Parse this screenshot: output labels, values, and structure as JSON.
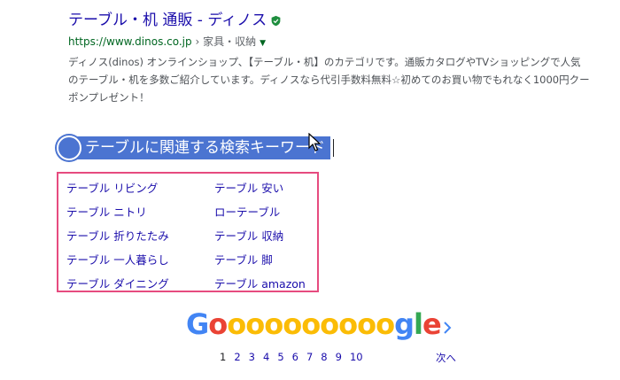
{
  "result": {
    "title": "テーブル・机 通販 - ディノス",
    "url": "https://www.dinos.co.jp",
    "breadcrumb": " › 家具・収納",
    "dropdown_glyph": "▼",
    "snippet": "ディノス(dinos) オンラインショップ、【テーブル・机】のカテゴリです。通販カタログやTVショッピングで人気のテーブル・机を多数ご紹介しています。ディノスなら代引手数料無料☆初めてのお買い物でもれなく1000円クーポンプレゼント！"
  },
  "related": {
    "heading": "テーブルに関連する検索キーワード",
    "items": [
      "テーブル リビング",
      "テーブル 安い",
      "テーブル ニトリ",
      "ローテーブル",
      "テーブル 折りたたみ",
      "テーブル 収納",
      "テーブル 一人暮らし",
      "テーブル 脚",
      "テーブル ダイニング",
      "テーブル amazon"
    ]
  },
  "pagination": {
    "logo_letters": [
      "G",
      "o",
      "o",
      "o",
      "o",
      "o",
      "o",
      "o",
      "o",
      "o",
      "o",
      "g",
      "l",
      "e"
    ],
    "pages": [
      "1",
      "2",
      "3",
      "4",
      "5",
      "6",
      "7",
      "8",
      "9",
      "10"
    ],
    "current_page": "1",
    "next_label": "次へ"
  },
  "colors": {
    "link": "#1a0dab",
    "url_green": "#006621",
    "selection": "#4b74d1",
    "highlight_box": "#e64b7f"
  }
}
